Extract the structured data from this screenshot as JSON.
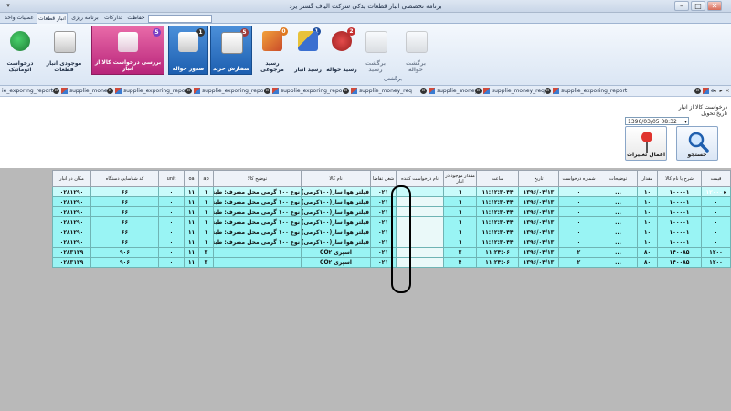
{
  "window": {
    "title": "برنامه تخصصی انبار قطعات یدکی شرکت الیاف گستر یزد",
    "qat_icon": "▾"
  },
  "tabs": [
    {
      "label": "عملیات واحد"
    },
    {
      "label": "انبار قطعات"
    },
    {
      "label": "برنامه ریزی"
    },
    {
      "label": "تدارکات"
    },
    {
      "label": "حفاظت"
    }
  ],
  "ribbon": {
    "group_caption": "برگشتی",
    "buttons": [
      {
        "label": "درخواست اتوماتیک",
        "badge": ""
      },
      {
        "label": "موجودی انبار قطعات",
        "badge": ""
      },
      {
        "label": "بررسی درخواست کالا از انبار",
        "badge": "5"
      },
      {
        "label": "صدور حواله",
        "badge": "1"
      },
      {
        "label": "سفارش خرید",
        "badge": "5"
      },
      {
        "label": "رسید مرجوعی",
        "badge": "0"
      },
      {
        "label": "رسید انبار",
        "badge": "1"
      },
      {
        "label": "رسید حواله",
        "badge": "2"
      },
      {
        "label": "برگشت رسید",
        "badge": ""
      },
      {
        "label": "برگشت حواله",
        "badge": ""
      }
    ]
  },
  "doc_tabs": [
    "ie_exporing_report",
    "supplie_money",
    "supplie_exporing_report",
    "supplie_exporing_report",
    "supplie_exporing_report",
    "supplie_money_req",
    "supplie_money",
    "supplie_money_req",
    "supplie_exporing_report",
    "e"
  ],
  "filter": {
    "label": "درخواست کالا از انبار",
    "date_label": "تاریخ تحویل",
    "date_value": "1396/03/05 08:32",
    "search_label": "جستجو",
    "apply_label": "اعمال تغییرات"
  },
  "grid": {
    "columns": [
      "قیمت",
      "شرح یا نام کالا",
      "مقدار",
      "توضیحات",
      "شماره درخواست",
      "تاریخ",
      "ساعت",
      "مقدار موجود در انبار",
      "نام درخواست کننده",
      "شغل تقاضا",
      "نام کالا",
      "توضیح کالا",
      "ap",
      "oa",
      "unit",
      "کد شناسایی دستگاه",
      "مکان در انبار"
    ],
    "rows": [
      [
        "۱۲۰۰۰۰",
        "۱۰۰۰۰۱",
        "۱۰",
        "...",
        "۰",
        "۱۳۹۶/۰۴/۱۳",
        "۱۱:۱۲:۳۰۴۴",
        "۱",
        "",
        "۰۲۱",
        "فیلتر هوا ساز(۱۰۰کرمی)",
        "نوع ۱۰۰ گرمی محل مصرف: طبقه اول",
        "۱",
        "۱۱",
        "۰",
        "۶۶",
        "۰۲۸۱۲۹۰"
      ],
      [
        "۰",
        "۱۰۰۰۰۱",
        "۱۰",
        "...",
        "۰",
        "۱۳۹۶/۰۴/۱۳",
        "۱۱:۱۲:۳۰۴۴",
        "۱",
        "",
        "۰۲۱",
        "فیلتر هوا ساز(۱۰۰کرمی)",
        "نوع ۱۰۰ گرمی محل مصرف: طبقه اول",
        "۱",
        "۱۱",
        "۰",
        "۶۶",
        "۰۲۸۱۲۹۰"
      ],
      [
        "۰",
        "۱۰۰۰۰۱",
        "۱۰",
        "...",
        "۰",
        "۱۳۹۶/۰۴/۱۳",
        "۱۱:۱۲:۳۰۴۴",
        "۱",
        "",
        "۰۲۱",
        "فیلتر هوا ساز(۱۰۰کرمی)",
        "نوع ۱۰۰ گرمی محل مصرف: طبقه اول",
        "۱",
        "۱۱",
        "۰",
        "۶۶",
        "۰۲۸۱۲۹۰"
      ],
      [
        "۰",
        "۱۰۰۰۰۱",
        "۱۰",
        "...",
        "۰",
        "۱۳۹۶/۰۴/۱۳",
        "۱۱:۱۲:۳۰۴۴",
        "۱",
        "",
        "۰۲۱",
        "فیلتر هوا ساز(۱۰۰کرمی)",
        "نوع ۱۰۰ گرمی محل مصرف: طبقه اول",
        "۱",
        "۱۱",
        "۰",
        "۶۶",
        "۰۲۸۱۲۹۰"
      ],
      [
        "۰",
        "۱۰۰۰۰۱",
        "۱۰",
        "...",
        "۰",
        "۱۳۹۶/۰۴/۱۳",
        "۱۱:۱۲:۳۰۴۴",
        "۱",
        "",
        "۰۲۱",
        "فیلتر هوا ساز(۱۰۰کرمی)",
        "نوع ۱۰۰ گرمی محل مصرف: طبقه اول",
        "۱",
        "۱۱",
        "۰",
        "۶۶",
        "۰۲۸۱۲۹۰"
      ],
      [
        "۰",
        "۱۰۰۰۰۱",
        "۱۰",
        "...",
        "۰",
        "۱۳۹۶/۰۴/۱۳",
        "۱۱:۱۲:۳۰۴۴",
        "۱",
        "",
        "۰۲۱",
        "فیلتر هوا ساز(۱۰۰کرمی)",
        "نوع ۱۰۰ گرمی محل مصرف: طبقه اول",
        "۱",
        "۱۱",
        "۰",
        "۶۶",
        "۰۲۸۱۲۹۰"
      ],
      [
        "۱۲۰۰",
        "۱۴۰۰۸۵",
        "۸۰",
        "...",
        "۲",
        "۱۳۹۶/۰۴/۱۳",
        "۱۱:۲۴:۰۶",
        "۳",
        "",
        "۰۲۱",
        "اسپری CO۲",
        "",
        "۳",
        "۱۱",
        "۰",
        "۹۰۶",
        "۰۲۸۳۱۲۹"
      ],
      [
        "۱۲۰۰",
        "۱۴۰۰۸۵",
        "۸۰",
        "...",
        "۲",
        "۱۳۹۶/۰۴/۱۳",
        "۱۱:۲۴:۰۶",
        "۴",
        "",
        "۰۲۱",
        "اسپری CO۲",
        "",
        "۳",
        "۱۱",
        "۰",
        "۹۰۶",
        "۰۲۸۳۱۲۹"
      ]
    ],
    "row_indicator": "▸"
  }
}
